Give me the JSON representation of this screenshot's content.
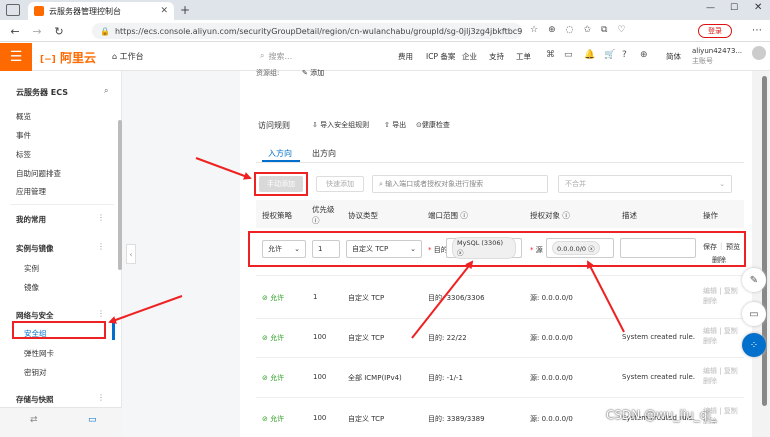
{
  "browser": {
    "tab_title": "云服务器管理控制台",
    "url": "https://ecs.console.aliyun.com/securityGroupDetail/region/cn-wulanchabu/groupId/sg-0jlj3zg4jbkftbc9...",
    "login_label": "登录"
  },
  "header": {
    "logo": "阿里云",
    "workbench": "工作台",
    "search_placeholder": "搜索...",
    "nav": [
      "费用",
      "ICP 备案",
      "企业",
      "支持",
      "工单"
    ],
    "lang": "简体",
    "user_name": "aliyun42473...",
    "user_role": "主账号"
  },
  "sidebar": {
    "title": "云服务器 ECS",
    "items": [
      "概览",
      "事件",
      "标签",
      "自助问题排查",
      "应用管理"
    ],
    "favorites": "我的常用",
    "group_instances": "实例与镜像",
    "instances_sub": [
      "实例",
      "镜像"
    ],
    "group_network": "网络与安全",
    "network_sub": [
      "安全组",
      "弹性网卡",
      "密钥对"
    ],
    "group_storage": "存储与快照"
  },
  "main": {
    "top_label": "资源组:",
    "top_link": "添加",
    "section_title": "访问规则",
    "import_link": "导入安全组规则",
    "export_link": "导出",
    "health_link": "健康检查",
    "tabs": [
      "入方向",
      "出方向"
    ],
    "add_button": "手动添加",
    "quick_add_button": "快速添加",
    "filter_placeholder": "输入端口或者授权对象进行搜索",
    "merge_select": "不合并",
    "columns": [
      "授权策略",
      "优先级",
      "协议类型",
      "端口范围",
      "授权对象",
      "描述",
      "操作"
    ],
    "edit_row": {
      "policy": "允许",
      "priority": "1",
      "protocol": "自定义 TCP",
      "port_prefix": "目的",
      "port_tag": "MySQL (3306)",
      "source_prefix": "源",
      "source_tag": "0.0.0.0/0",
      "save": "保存",
      "preview": "预览",
      "delete": "删除"
    },
    "rows": [
      {
        "policy": "允许",
        "priority": "1",
        "protocol": "自定义 TCP",
        "port": "目的: 3306/3306",
        "source": "源: 0.0.0.0/0",
        "desc": "",
        "edit": "编辑",
        "copy": "复制",
        "del": "删除"
      },
      {
        "policy": "允许",
        "priority": "100",
        "protocol": "自定义 TCP",
        "port": "目的: 22/22",
        "source": "源: 0.0.0.0/0",
        "desc": "System created rule.",
        "edit": "编辑",
        "copy": "复制",
        "del": "删除"
      },
      {
        "policy": "允许",
        "priority": "100",
        "protocol": "全部 ICMP(IPv4)",
        "port": "目的: -1/-1",
        "source": "源: 0.0.0.0/0",
        "desc": "System created rule.",
        "edit": "编辑",
        "copy": "复制",
        "del": "删除"
      },
      {
        "policy": "允许",
        "priority": "100",
        "protocol": "自定义 TCP",
        "port": "目的: 3389/3389",
        "source": "源: 0.0.0.0/0",
        "desc": "System created rule.",
        "edit": "编辑",
        "copy": "复制",
        "del": "删除"
      }
    ]
  },
  "watermark": "CSDN @wu_liu_qi_",
  "colors": {
    "accent": "#ff6a00",
    "link": "#0070cc",
    "annotation": "#e22222",
    "ok": "#2ea121"
  }
}
